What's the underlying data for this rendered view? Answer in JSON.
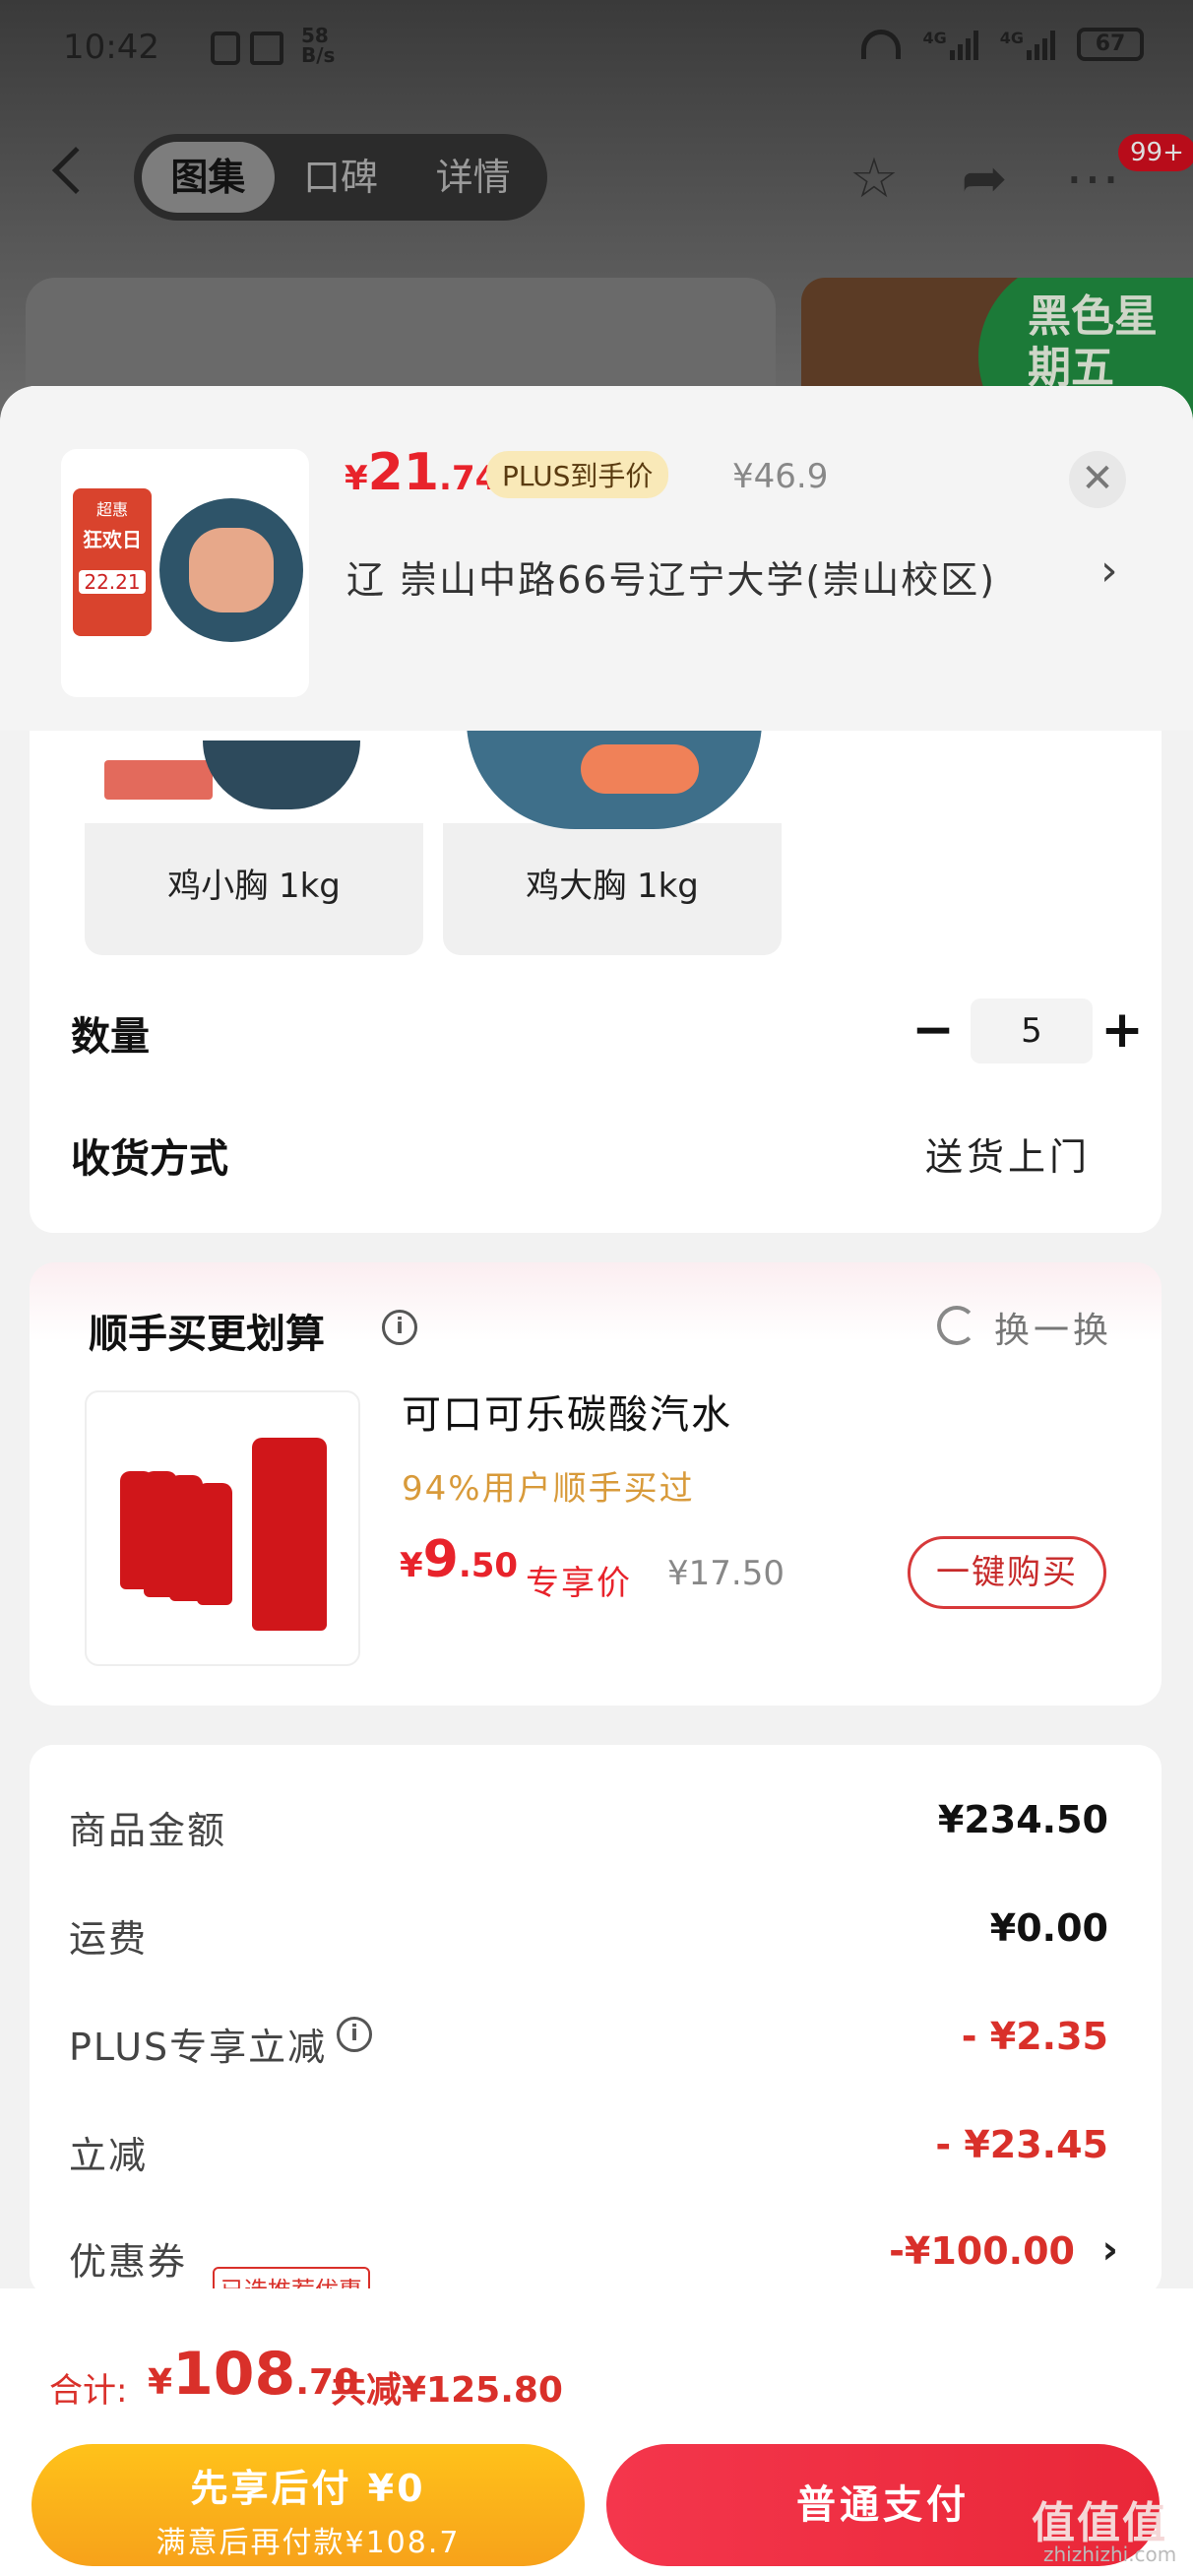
{
  "status_bar": {
    "time": "10:42",
    "net_speed_top": "58",
    "net_speed_unit": "B/s",
    "signal1": "4G",
    "signal2": "4G",
    "battery": "67"
  },
  "nav": {
    "tabs": [
      {
        "label": "图集",
        "active": true
      },
      {
        "label": "口碑",
        "active": false
      },
      {
        "label": "详情",
        "active": false
      }
    ],
    "badge": "99+"
  },
  "background_promo": {
    "text": "黑色星期五"
  },
  "product": {
    "price_symbol": "¥",
    "price_int": "21",
    "price_dec": ".74",
    "plus_tag": "PLUS到手价",
    "original_price": "¥46.9",
    "address": "辽   崇山中路66号辽宁大学(崇山校区)",
    "thumb_promo_line1": "超惠",
    "thumb_promo_line2": "狂欢日",
    "thumb_promo_price": "22.21"
  },
  "variants": [
    {
      "label": "鸡小胸 1kg"
    },
    {
      "label": "鸡大胸 1kg"
    }
  ],
  "quantity": {
    "label": "数量",
    "minus": "−",
    "value": "5",
    "plus": "+"
  },
  "delivery": {
    "label": "收货方式",
    "value": "送货上门"
  },
  "addon": {
    "title": "顺手买更划算",
    "refresh_label": "换一换",
    "name": "可口可乐碳酸汽水",
    "stat": "94%用户顺手买过",
    "price_symbol": "¥",
    "price_int": "9",
    "price_dec": ".50",
    "exclusive_label": "专享价",
    "original_price": "¥17.50",
    "buy_button": "一键购买"
  },
  "summary": {
    "rows": [
      {
        "label": "商品金额",
        "value": "¥234.50"
      },
      {
        "label": "运费",
        "value": "¥0.00"
      },
      {
        "label": "PLUS专享立减",
        "value": "- ¥2.35"
      },
      {
        "label": "立减",
        "value": "- ¥23.45"
      },
      {
        "label": "优惠券",
        "value": "-¥100.00"
      }
    ],
    "coupon_tag": "已选推荐优惠"
  },
  "bottom": {
    "total_label": "合计:",
    "total_symbol": "¥",
    "total_int": "108",
    "total_dec": ".70",
    "discount": "共减¥125.80",
    "pay_later_line1": "先享后付 ¥0",
    "pay_later_line2": "满意后再付款¥108.7",
    "pay_normal": "普通支付"
  },
  "watermark": {
    "text": "值值值",
    "sub": "zhizhizhi.com"
  },
  "colors": {
    "accent_red": "#e8232b",
    "pay_later": "#ffc21a",
    "pay_normal": "#f4364c",
    "plus_tag_bg": "#f9e9b8"
  }
}
